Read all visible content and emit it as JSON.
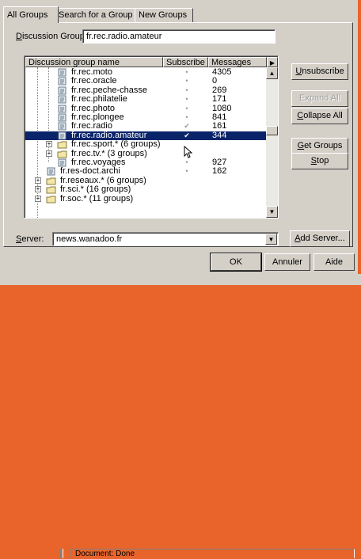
{
  "tabs": [
    "All Groups",
    "Search for a Group",
    "New Groups"
  ],
  "discussion_group": {
    "label_hotkey": "D",
    "label_rest": "iscussion Group:",
    "value": "fr.rec.radio.amateur"
  },
  "columns": {
    "name": "Discussion group name",
    "subscribe": "Subscribe",
    "messages": "Messages"
  },
  "rows": [
    {
      "name": "fr.rec.moto",
      "sub": "•",
      "messages": "4305"
    },
    {
      "name": "fr.rec.oracle",
      "sub": "•",
      "messages": "0"
    },
    {
      "name": "fr.rec.peche-chasse",
      "sub": "•",
      "messages": "269"
    },
    {
      "name": "fr.rec.philatelie",
      "sub": "•",
      "messages": "171"
    },
    {
      "name": "fr.rec.photo",
      "sub": "•",
      "messages": "1080"
    },
    {
      "name": "fr.rec.plongee",
      "sub": "•",
      "messages": "841"
    },
    {
      "name": "fr.rec.radio",
      "sub": "✔",
      "messages": "161"
    },
    {
      "name": "fr.rec.radio.amateur",
      "sub": "✔",
      "messages": "344"
    },
    {
      "name": "fr.rec.sport.* (6 groups)",
      "sub": "",
      "messages": ""
    },
    {
      "name": "fr.rec.tv.* (3 groups)",
      "sub": "",
      "messages": ""
    },
    {
      "name": "fr.rec.voyages",
      "sub": "•",
      "messages": "927"
    },
    {
      "name": "fr.res-doct.archi",
      "sub": "•",
      "messages": "162"
    },
    {
      "name": "fr.reseaux.* (6 groups)",
      "sub": "",
      "messages": ""
    },
    {
      "name": "fr.sci.* (16 groups)",
      "sub": "",
      "messages": ""
    },
    {
      "name": "fr.soc.* (11 groups)",
      "sub": "",
      "messages": ""
    }
  ],
  "side_buttons": {
    "unsubscribe": {
      "hotkey": "U",
      "rest": "nsubscribe"
    },
    "expand_all": "Expand All",
    "collapse_all": {
      "hotkey": "C",
      "rest": "ollapse All"
    },
    "get_groups": {
      "hotkey": "G",
      "rest": "et Groups"
    },
    "stop": {
      "hotkey": "S",
      "rest": "top"
    }
  },
  "server": {
    "label_hotkey": "S",
    "label_rest": "erver:",
    "value": "news.wanadoo.fr"
  },
  "add_server": {
    "hotkey": "A",
    "rest": "dd Server..."
  },
  "footer": {
    "ok": "OK",
    "cancel": "Annuler",
    "help": "Aide"
  },
  "status": "Document: Done",
  "colors": {
    "selection": "#0a246a",
    "window_bg": "#d4d0c8",
    "desktop": "#e8642a"
  }
}
